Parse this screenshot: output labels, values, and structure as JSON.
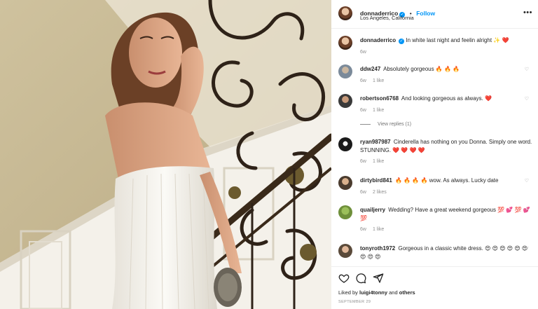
{
  "post": {
    "author": "donnaderrico",
    "follow_label": "Follow",
    "separator": "•",
    "location": "Los Angeles, California",
    "more_icon": "more-options-icon",
    "photo": {
      "description_colors": {
        "wall": "#d2c5a2",
        "dress": "#f3f1ec",
        "hair": "#6b4026",
        "railing": "#2e2218"
      }
    }
  },
  "comments": [
    {
      "user": "donnaderrico",
      "verified": true,
      "text": "In white last night and feelin alright ✨ ❤️",
      "time": "6w",
      "likes": "",
      "reply": ""
    },
    {
      "user": "ddw247",
      "text": "Absolutely gorgeous 🔥 🔥 🔥",
      "time": "6w",
      "likes": "1 like",
      "reply": ""
    },
    {
      "user": "robertson6768",
      "text": "And looking gorgeous as always. ❤️",
      "time": "6w",
      "likes": "1 like",
      "reply": ""
    },
    {
      "user": "ryan987987",
      "text": "Cinderella has nothing on you Donna. Simply one word. STUNNING. ❤️ ❤️ ❤️ ❤️",
      "time": "6w",
      "likes": "1 like",
      "reply": ""
    },
    {
      "user": "dirtybird841",
      "text": "🔥 🔥 🔥 🔥 wow. As always. Lucky date",
      "time": "6w",
      "likes": "2 likes",
      "reply": ""
    },
    {
      "user": "quailjerry",
      "text": "Wedding? Have a great weekend gorgeous 💯 💕 💯 💕 💯",
      "time": "6w",
      "likes": "1 like",
      "reply": ""
    },
    {
      "user": "tonyroth1972",
      "text": "Gorgeous in a classic white dress. 😍 😍 😍 😍 😍 😍 😍 😍 😍",
      "time": "",
      "likes": "",
      "reply": ""
    }
  ],
  "view_replies": "View replies (1)",
  "footer": {
    "liked_by_prefix": "Liked by",
    "liked_by_user": "luigi4tonny",
    "liked_by_and": "and",
    "liked_by_others": "others",
    "date": "SEPTEMBER 29"
  },
  "icons": [
    "heart-icon",
    "comment-icon",
    "share-icon",
    "verified-icon"
  ],
  "colors": {
    "accent": "#0095f6",
    "muted": "#8e8e8e",
    "text": "#262626",
    "like_red": "#ed4956"
  }
}
